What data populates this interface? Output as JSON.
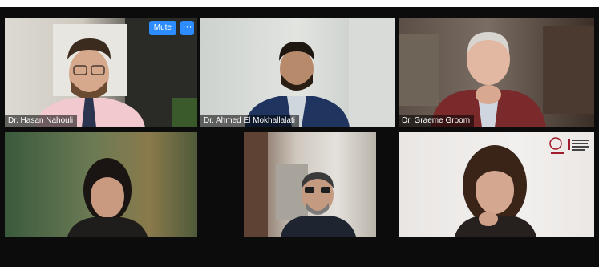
{
  "participants": [
    {
      "name": "Dr. Hasan Nahouli"
    },
    {
      "name": "Dr. Ahmed El Mokhallalati"
    },
    {
      "name": "Dr. Graeme Groom"
    },
    {
      "name": ""
    },
    {
      "name": ""
    },
    {
      "name": ""
    }
  ],
  "controls": {
    "mute_label": "Mute",
    "more_label": "···"
  },
  "colors": {
    "window_bg": "#0c0c0c",
    "accent": "#2d8cff"
  },
  "icons": {
    "more": "ellipsis-icon",
    "logo": "university-logo"
  }
}
